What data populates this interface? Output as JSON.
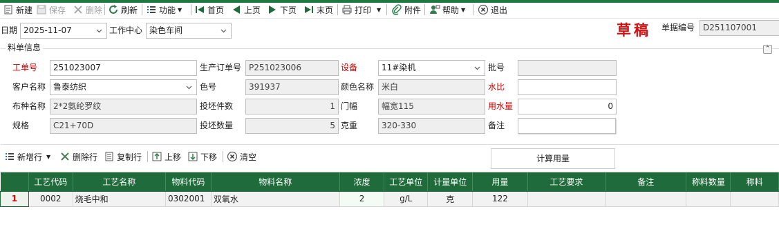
{
  "toolbar": {
    "items": [
      {
        "label": "新建",
        "icon": "new-doc-icon",
        "enabled": true
      },
      {
        "label": "保存",
        "icon": "save-icon",
        "enabled": false
      },
      {
        "label": "删除",
        "icon": "delete-icon",
        "enabled": false
      },
      {
        "label": "刷新",
        "icon": "refresh-icon",
        "enabled": true
      },
      {
        "label": "功能",
        "icon": "list-icon",
        "enabled": true
      },
      {
        "label": "首页",
        "icon": "first-page-icon",
        "enabled": true
      },
      {
        "label": "上页",
        "icon": "prev-page-icon",
        "enabled": true
      },
      {
        "label": "下页",
        "icon": "next-page-icon",
        "enabled": true
      },
      {
        "label": "末页",
        "icon": "last-page-icon",
        "enabled": true
      },
      {
        "label": "打印",
        "icon": "print-icon",
        "enabled": true
      },
      {
        "label": "附件",
        "icon": "paperclip-icon",
        "enabled": true
      },
      {
        "label": "帮助",
        "icon": "help-icon",
        "enabled": true
      },
      {
        "label": "退出",
        "icon": "exit-icon",
        "enabled": true
      }
    ]
  },
  "header": {
    "date_label": "日期",
    "date_value": "2025-11-07",
    "work_center_label": "工作中心",
    "work_center_value": "染色车间",
    "status_stamp": "草稿",
    "doc_no_label": "单据编号",
    "doc_no_value": "D251107001"
  },
  "group": {
    "title": "料单信息",
    "fields": {
      "work_order_label": "工单号",
      "work_order_value": "251023007",
      "prod_order_label": "生产订单号",
      "prod_order_value": "P251023006",
      "equipment_label": "设备",
      "equipment_value": "11#染机",
      "batch_label": "批号",
      "batch_value": "",
      "customer_label": "客户名称",
      "customer_value": "鲁泰纺织",
      "color_no_label": "色号",
      "color_no_value": "391937",
      "color_name_label": "颜色名称",
      "color_name_value": "米白",
      "water_ratio_label": "水比",
      "water_ratio_value": "",
      "fabric_label": "布种名称",
      "fabric_value": "2*2氨纶罗纹",
      "pieces_label": "投坯件数",
      "pieces_value": "1",
      "width_label": "门幅",
      "width_value": "幅宽115",
      "water_label": "用水量",
      "water_value": "0",
      "spec_label": "规格",
      "spec_value": "C21+70D",
      "qty_label": "投坯数量",
      "qty_value": "5",
      "gram_label": "克重",
      "gram_value": "320-330",
      "remark_label": "备注",
      "remark_value": ""
    }
  },
  "grid_toolbar": {
    "add_row": "新增行",
    "delete_row": "删除行",
    "copy_row": "复制行",
    "move_up": "上移",
    "move_down": "下移",
    "clear": "清空",
    "calc": "计算用量"
  },
  "grid": {
    "columns": [
      "",
      "工艺代码",
      "工艺名称",
      "物料代码",
      "物料名称",
      "浓度",
      "工艺单位",
      "计量单位",
      "用量",
      "工艺要求",
      "备注",
      "称料数量",
      "称料"
    ],
    "rows": [
      [
        "1",
        "0002",
        "烧毛中和",
        "0302001",
        "双氧水",
        "2",
        "g/L",
        "克",
        "122",
        "",
        "",
        "",
        ""
      ]
    ]
  },
  "colors": {
    "accent": "#1f6b3b",
    "required_label": "#d10000",
    "stamp": "#d01212"
  }
}
